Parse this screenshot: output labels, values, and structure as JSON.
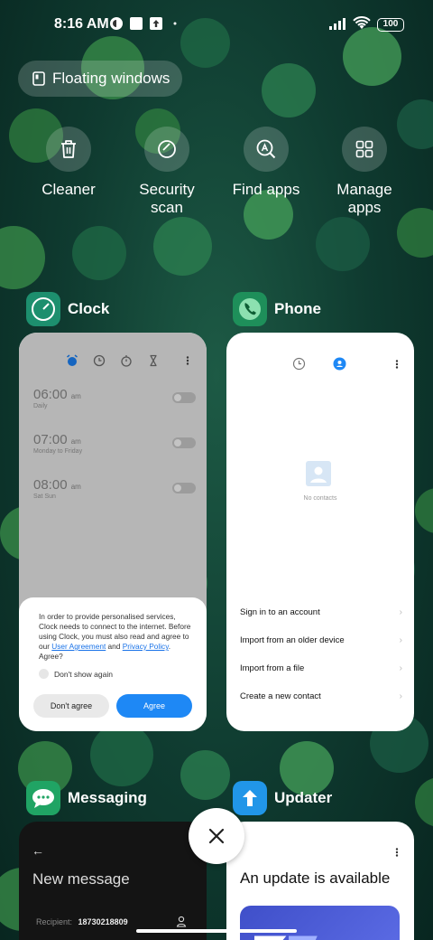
{
  "status": {
    "time": "8:16 AM",
    "battery": "100"
  },
  "floating": {
    "label": "Floating windows"
  },
  "tools": [
    {
      "label": "Cleaner",
      "icon": "trash-icon"
    },
    {
      "label": "Security scan",
      "icon": "shield-check-icon"
    },
    {
      "label": "Find apps",
      "icon": "search-apps-icon"
    },
    {
      "label": "Manage apps",
      "icon": "grid-icon"
    }
  ],
  "apps": {
    "clock": {
      "name": "Clock",
      "alarms": [
        {
          "time": "06:00",
          "ampm": "am",
          "repeat": "Daily"
        },
        {
          "time": "07:00",
          "ampm": "am",
          "repeat": "Monday to Friday"
        },
        {
          "time": "08:00",
          "ampm": "am",
          "repeat": "Sat Sun"
        }
      ],
      "consent": {
        "text_before": "In order to provide personalised services, Clock needs to connect to the internet. Before using Clock, you must also read and agree to our ",
        "link1": "User Agreement",
        "and": " and ",
        "link2": "Privacy Policy",
        "text_after": ". Agree?",
        "checkbox": "Don't show again",
        "disagree": "Don't agree",
        "agree": "Agree"
      }
    },
    "phone": {
      "name": "Phone",
      "empty": "No contacts",
      "menu": [
        "Sign in to an account",
        "Import from an older device",
        "Import from a file",
        "Create a new contact"
      ]
    },
    "messaging": {
      "name": "Messaging",
      "title": "New message",
      "recipient_label": "Recipient:",
      "recipient_value": "18730218809"
    },
    "updater": {
      "name": "Updater",
      "title": "An update is available"
    }
  },
  "colors": {
    "accent": "#1e88f5",
    "clock_icon": "#1d8f6e",
    "phone_icon": "#1e8f5a",
    "messaging_icon": "#20a464",
    "updater_icon": "#2196e8"
  }
}
